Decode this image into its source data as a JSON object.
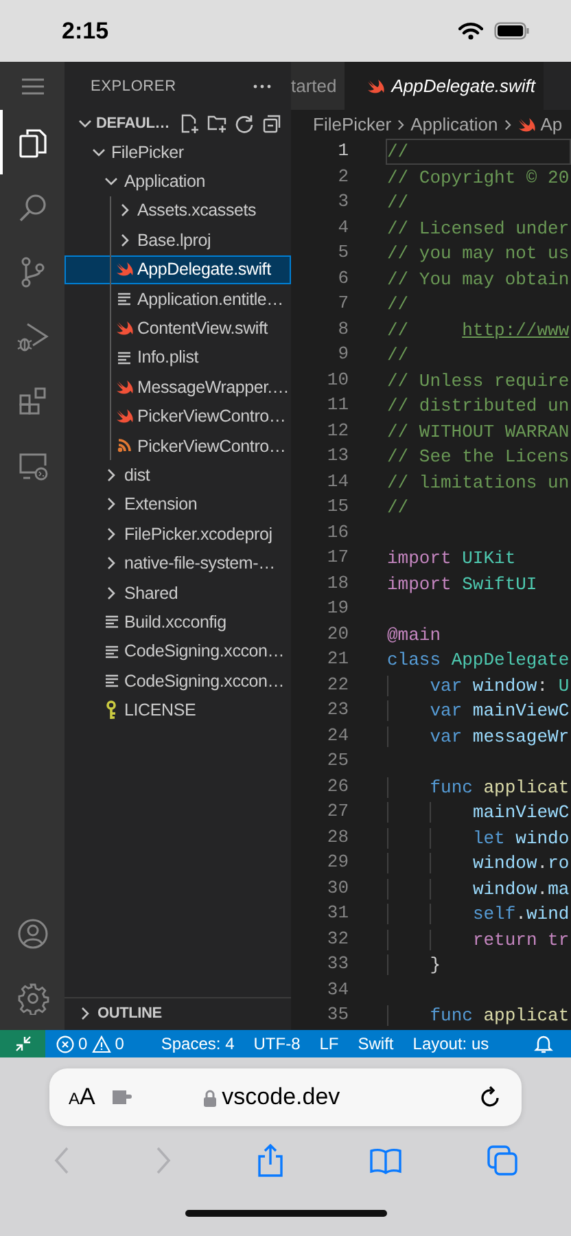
{
  "phone_status": {
    "time": "2:15"
  },
  "activity_bar": {
    "items": [
      {
        "kind": "explorer",
        "selected": true
      },
      {
        "kind": "search",
        "selected": false
      },
      {
        "kind": "source-control",
        "selected": false
      },
      {
        "kind": "run-debug",
        "selected": false
      },
      {
        "kind": "extensions",
        "selected": false
      },
      {
        "kind": "remote",
        "selected": false
      }
    ],
    "bottom_items": [
      {
        "kind": "account"
      },
      {
        "kind": "settings"
      }
    ]
  },
  "explorer": {
    "title": "EXPLORER",
    "root": {
      "label": "DEFAUL…",
      "expanded": true
    },
    "tree": [
      {
        "label": "FilePicker",
        "kind": "folder",
        "expanded": true,
        "selected": false,
        "children": [
          {
            "label": "Application",
            "kind": "folder",
            "expanded": true,
            "selected": false,
            "children": [
              {
                "label": "Assets.xcassets",
                "kind": "folder",
                "expanded": false,
                "selected": false
              },
              {
                "label": "Base.lproj",
                "kind": "folder",
                "expanded": false,
                "selected": false
              },
              {
                "label": "AppDelegate.swift",
                "kind": "swift",
                "selected": true
              },
              {
                "label": "Application.entitle…",
                "kind": "file",
                "selected": false
              },
              {
                "label": "ContentView.swift",
                "kind": "swift",
                "selected": false
              },
              {
                "label": "Info.plist",
                "kind": "file",
                "selected": false
              },
              {
                "label": "MessageWrapper.…",
                "kind": "swift",
                "selected": false
              },
              {
                "label": "PickerViewContro…",
                "kind": "swift",
                "selected": false
              },
              {
                "label": "PickerViewContro…",
                "kind": "xib",
                "selected": false
              }
            ]
          },
          {
            "label": "dist",
            "kind": "folder",
            "expanded": false,
            "selected": false
          },
          {
            "label": "Extension",
            "kind": "folder",
            "expanded": false,
            "selected": false
          },
          {
            "label": "FilePicker.xcodeproj",
            "kind": "folder",
            "expanded": false,
            "selected": false
          },
          {
            "label": "native-file-system-…",
            "kind": "folder",
            "expanded": false,
            "selected": false
          },
          {
            "label": "Shared",
            "kind": "folder",
            "expanded": false,
            "selected": false
          },
          {
            "label": "Build.xcconfig",
            "kind": "file",
            "selected": false
          },
          {
            "label": "CodeSigning.xccon…",
            "kind": "file",
            "selected": false
          },
          {
            "label": "CodeSigning.xccon…",
            "kind": "file",
            "selected": false
          },
          {
            "label": "LICENSE",
            "kind": "license",
            "selected": false
          }
        ]
      }
    ],
    "outline": {
      "label": "OUTLINE",
      "expanded": false
    }
  },
  "editor": {
    "tabs": [
      {
        "label": "tarted",
        "kind": "plain",
        "selected": false,
        "preview": false
      },
      {
        "label": "AppDelegate.swift",
        "kind": "swift",
        "selected": true,
        "preview": true
      }
    ],
    "breadcrumbs": [
      {
        "label": "FilePicker",
        "kind": "folder"
      },
      {
        "label": "Application",
        "kind": "folder"
      },
      {
        "label": "Ap",
        "kind": "swift"
      }
    ],
    "lines": [
      {
        "number": "1",
        "current": true,
        "tokens": [
          {
            "kind": "comment",
            "text": "//"
          }
        ]
      },
      {
        "number": "2",
        "current": false,
        "tokens": [
          {
            "kind": "comment",
            "text": "// Copyright © 20"
          }
        ]
      },
      {
        "number": "3",
        "current": false,
        "tokens": [
          {
            "kind": "comment",
            "text": "//"
          }
        ]
      },
      {
        "number": "4",
        "current": false,
        "tokens": [
          {
            "kind": "comment",
            "text": "// Licensed under"
          }
        ]
      },
      {
        "number": "5",
        "current": false,
        "tokens": [
          {
            "kind": "comment",
            "text": "// you may not us"
          }
        ]
      },
      {
        "number": "6",
        "current": false,
        "tokens": [
          {
            "kind": "comment",
            "text": "// You may obtain"
          }
        ]
      },
      {
        "number": "7",
        "current": false,
        "tokens": [
          {
            "kind": "comment",
            "text": "//"
          }
        ]
      },
      {
        "number": "8",
        "current": false,
        "tokens": [
          {
            "kind": "comment",
            "text": "//     "
          },
          {
            "kind": "link",
            "text": "http://www"
          }
        ]
      },
      {
        "number": "9",
        "current": false,
        "tokens": [
          {
            "kind": "comment",
            "text": "//"
          }
        ]
      },
      {
        "number": "10",
        "current": false,
        "tokens": [
          {
            "kind": "comment",
            "text": "// Unless require"
          }
        ]
      },
      {
        "number": "11",
        "current": false,
        "tokens": [
          {
            "kind": "comment",
            "text": "// distributed un"
          }
        ]
      },
      {
        "number": "12",
        "current": false,
        "tokens": [
          {
            "kind": "comment",
            "text": "// WITHOUT WARRAN"
          }
        ]
      },
      {
        "number": "13",
        "current": false,
        "tokens": [
          {
            "kind": "comment",
            "text": "// See the Licens"
          }
        ]
      },
      {
        "number": "14",
        "current": false,
        "tokens": [
          {
            "kind": "comment",
            "text": "// limitations un"
          }
        ]
      },
      {
        "number": "15",
        "current": false,
        "tokens": [
          {
            "kind": "comment",
            "text": "//"
          }
        ]
      },
      {
        "number": "16",
        "current": false
      },
      {
        "number": "17",
        "current": false,
        "tokens": [
          {
            "kind": "keyword",
            "text": "import"
          },
          {
            "kind": "type",
            "text": " UIKit"
          }
        ]
      },
      {
        "number": "18",
        "current": false,
        "tokens": [
          {
            "kind": "keyword",
            "text": "import"
          },
          {
            "kind": "type",
            "text": " SwiftUI"
          }
        ]
      },
      {
        "number": "19",
        "current": false
      },
      {
        "number": "20",
        "current": false,
        "tokens": [
          {
            "kind": "keyword",
            "text": "@main"
          }
        ]
      },
      {
        "number": "21",
        "current": false,
        "tokens": [
          {
            "kind": "storage",
            "text": "class"
          },
          {
            "kind": "type",
            "text": " AppDelegate"
          }
        ]
      },
      {
        "number": "22",
        "current": false,
        "tokens": [
          {
            "kind": "storage",
            "text": "    var"
          },
          {
            "kind": "variable",
            "text": " window"
          },
          {
            "kind": "plain",
            "text": ":"
          },
          {
            "kind": "type",
            "text": " U"
          }
        ]
      },
      {
        "number": "23",
        "current": false,
        "tokens": [
          {
            "kind": "storage",
            "text": "    var"
          },
          {
            "kind": "variable",
            "text": " mainViewC"
          }
        ]
      },
      {
        "number": "24",
        "current": false,
        "tokens": [
          {
            "kind": "storage",
            "text": "    var"
          },
          {
            "kind": "variable",
            "text": " messageWr"
          }
        ]
      },
      {
        "number": "25",
        "current": false
      },
      {
        "number": "26",
        "current": false,
        "tokens": [
          {
            "kind": "storage",
            "text": "    func"
          },
          {
            "kind": "function",
            "text": " applicat"
          }
        ]
      },
      {
        "number": "27",
        "current": false,
        "tokens": [
          {
            "kind": "variable",
            "text": "        mainViewC"
          }
        ]
      },
      {
        "number": "28",
        "current": false,
        "tokens": [
          {
            "kind": "storage",
            "text": "        let"
          },
          {
            "kind": "variable",
            "text": " windo"
          }
        ]
      },
      {
        "number": "29",
        "current": false,
        "tokens": [
          {
            "kind": "variable",
            "text": "        window"
          },
          {
            "kind": "plain",
            "text": "."
          },
          {
            "kind": "variable",
            "text": "ro"
          }
        ]
      },
      {
        "number": "30",
        "current": false,
        "tokens": [
          {
            "kind": "variable",
            "text": "        window"
          },
          {
            "kind": "plain",
            "text": "."
          },
          {
            "kind": "variable",
            "text": "ma"
          }
        ]
      },
      {
        "number": "31",
        "current": false,
        "tokens": [
          {
            "kind": "storage",
            "text": "        self"
          },
          {
            "kind": "plain",
            "text": "."
          },
          {
            "kind": "variable",
            "text": "wind"
          }
        ]
      },
      {
        "number": "32",
        "current": false,
        "tokens": [
          {
            "kind": "keyword",
            "text": "        return"
          },
          {
            "kind": "keyword",
            "text": " tr"
          }
        ]
      },
      {
        "number": "33",
        "current": false,
        "tokens": [
          {
            "kind": "plain",
            "text": "    }"
          }
        ]
      },
      {
        "number": "34",
        "current": false
      },
      {
        "number": "35",
        "current": false,
        "tokens": [
          {
            "kind": "storage",
            "text": "    func"
          },
          {
            "kind": "function",
            "text": " applicat"
          }
        ]
      }
    ]
  },
  "status_bar": {
    "errors": "0",
    "warnings": "0",
    "items": [
      "Spaces: 4",
      "UTF-8",
      "LF",
      "Swift",
      "Layout: us"
    ]
  },
  "safari": {
    "text_size": "AA",
    "url": "vscode.dev",
    "secure": true,
    "back_enabled": false,
    "forward_enabled": false
  }
}
